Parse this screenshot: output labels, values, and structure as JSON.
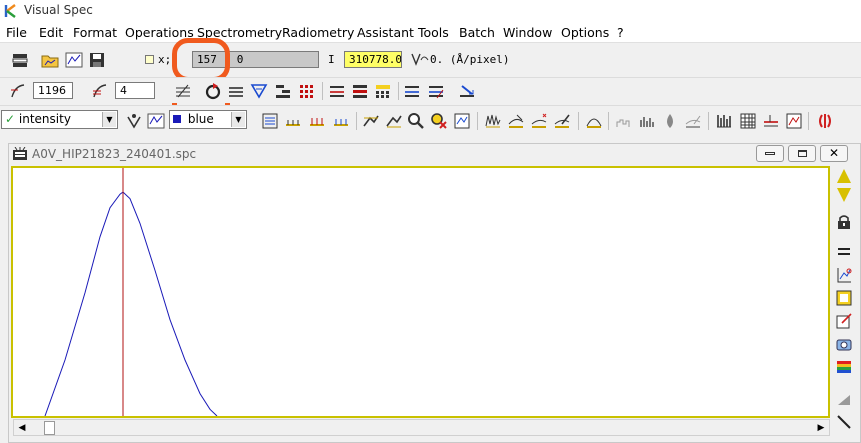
{
  "app": {
    "title": "Visual Spec"
  },
  "menu": [
    "File",
    "Edit",
    "Format",
    "Operations",
    "Spectrometry",
    "Radiometry",
    "Assistant",
    "Tools",
    "Batch",
    "Window",
    "Options",
    "?"
  ],
  "toolbar1": {
    "xy_label": "x;I",
    "xy_value": "157 ; 0",
    "i_label": "I",
    "i_value": "310778.0",
    "dispersion": "0. (Å/pixel)"
  },
  "toolbar2": {
    "field1": "1196",
    "field2": "4"
  },
  "toolbar3": {
    "series_select": "intensity",
    "color_select": "blue"
  },
  "document": {
    "title": "A0V_HIP21823_240401.spc"
  },
  "colors": {
    "highlight_circle": "#f05a1e",
    "plot_frame": "#c9c100",
    "spectrum_line": "#1a1ab8",
    "marker_line": "#b01010",
    "i_field_bg": "#ffff66"
  },
  "chart_data": {
    "type": "line",
    "series": [
      {
        "values": [
          [
            0,
            0.0
          ],
          [
            20,
            0.25
          ],
          [
            40,
            0.55
          ],
          [
            55,
            0.8
          ],
          [
            65,
            0.93
          ],
          [
            75,
            0.99
          ],
          [
            78,
            1.0
          ],
          [
            85,
            0.97
          ],
          [
            95,
            0.86
          ],
          [
            110,
            0.65
          ],
          [
            125,
            0.43
          ],
          [
            140,
            0.25
          ],
          [
            155,
            0.1
          ],
          [
            165,
            0.03
          ],
          [
            172,
            0.0
          ]
        ]
      }
    ],
    "marker_x": 78,
    "grid": false,
    "legend": "none"
  }
}
